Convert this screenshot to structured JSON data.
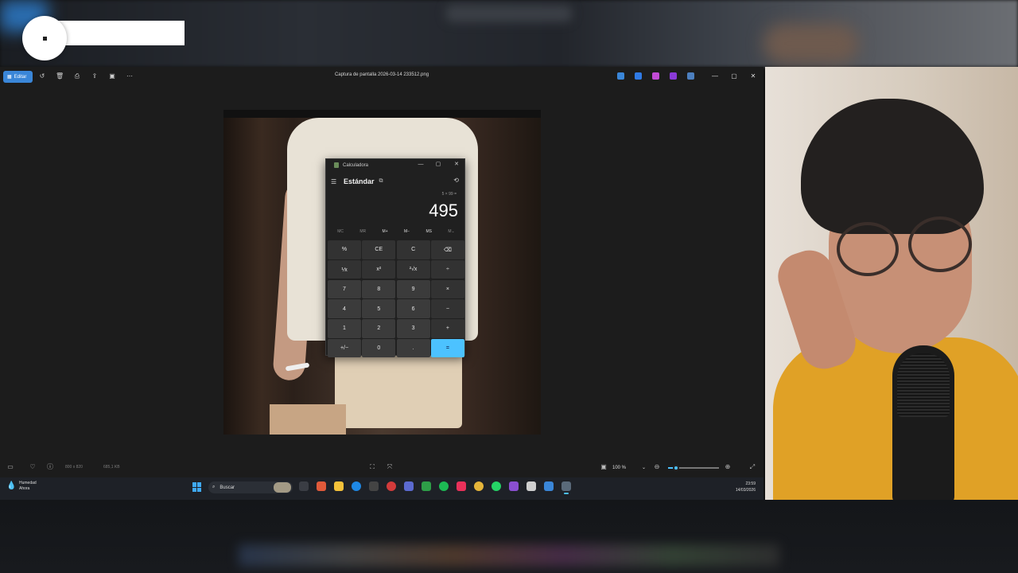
{
  "photos_app": {
    "edit_label": "Editar",
    "file_title": "Captura de pantalla 2026-03-14 233512.png",
    "image_dims": "800 x 820",
    "file_size": "685,1 KB",
    "zoom_level": "100 %",
    "zoom_fraction": 0.15
  },
  "calculator": {
    "title": "Calculadora",
    "mode": "Estándar",
    "expression": "5 × 99 =",
    "result": "495",
    "memory": [
      "MC",
      "MR",
      "M+",
      "M−",
      "MS",
      "M⌄"
    ],
    "keys": [
      "%",
      "CE",
      "C",
      "⌫",
      "⅟x",
      "x²",
      "²√x",
      "÷",
      "7",
      "8",
      "9",
      "×",
      "4",
      "5",
      "6",
      "−",
      "1",
      "2",
      "3",
      "+",
      "+/−",
      "0",
      ".",
      "="
    ]
  },
  "taskbar": {
    "weather_title": "Humedad",
    "weather_sub": "Ahora",
    "search_placeholder": "Buscar",
    "time": "23:59",
    "date": "14/03/2026"
  },
  "colors": {
    "accent": "#4cc2ff",
    "edit_button": "#3a86d8"
  }
}
